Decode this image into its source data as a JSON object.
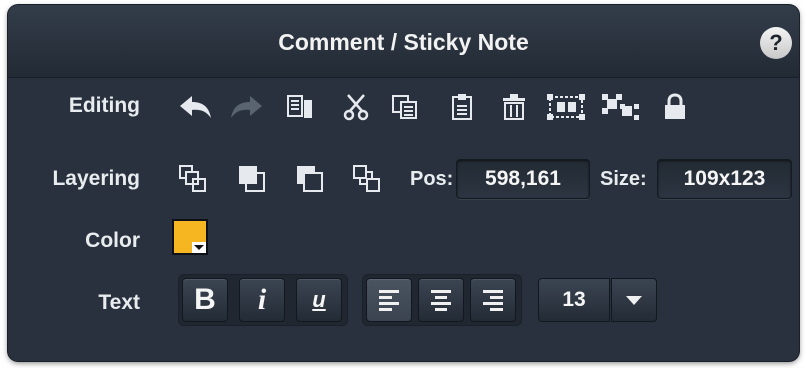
{
  "panel": {
    "title": "Comment / Sticky Note",
    "help_label": "?"
  },
  "rows": {
    "editing_label": "Editing",
    "layering_label": "Layering",
    "color_label": "Color",
    "text_label": "Text"
  },
  "editing_tools": [
    "undo-icon",
    "redo-icon",
    "copy-style-icon",
    "cut-icon",
    "copy-icon",
    "paste-icon",
    "delete-icon",
    "group-icon",
    "ungroup-icon",
    "lock-icon"
  ],
  "layering_tools": [
    "bring-to-front-icon",
    "bring-forward-icon",
    "send-backward-icon",
    "send-to-back-icon"
  ],
  "position": {
    "label": "Pos:",
    "value": "598,161"
  },
  "size": {
    "label": "Size:",
    "value": "109x123"
  },
  "color": {
    "value": "#f6b621"
  },
  "text": {
    "bold_label": "B",
    "italic_label": "i",
    "underline_label": "u",
    "alignment_selected": "left",
    "font_size": "13"
  },
  "colors": {
    "panel_bg": "#28313d",
    "icon_active": "#e6e9ee",
    "icon_disabled": "#5a6370"
  }
}
